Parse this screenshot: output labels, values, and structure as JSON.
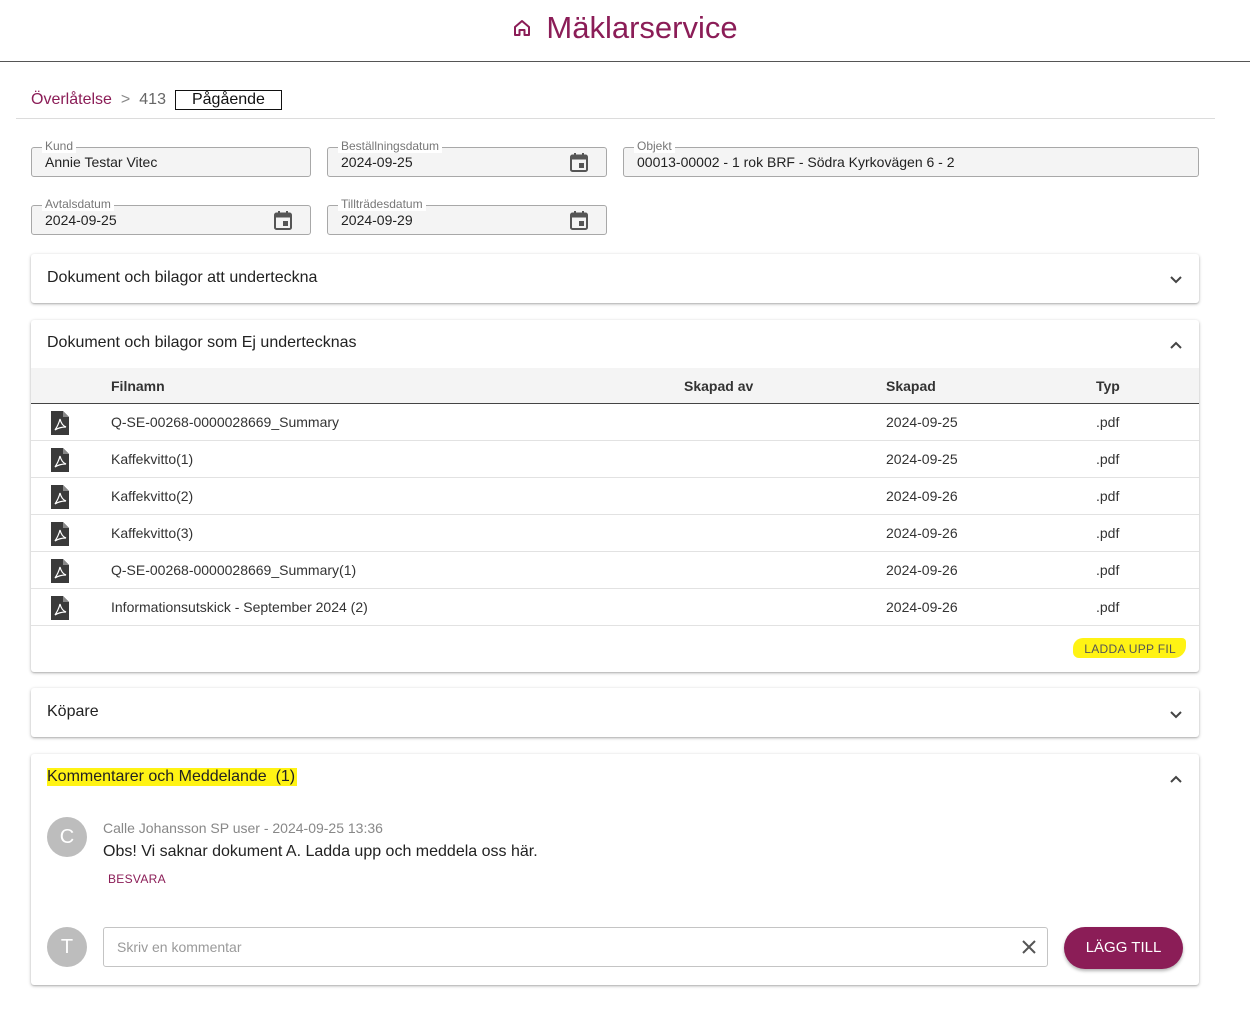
{
  "app": {
    "title": "Mäklarservice",
    "accent": "#8b1d57"
  },
  "breadcrumb": {
    "section": "Överlåtelse",
    "separator": ">",
    "id": "413",
    "status": "Pågående"
  },
  "fields": {
    "kund": {
      "label": "Kund",
      "value": "Annie Testar Vitec"
    },
    "bestallningsdatum": {
      "label": "Beställningsdatum",
      "value": "2024-09-25"
    },
    "objekt": {
      "label": "Objekt",
      "value": "00013-00002 - 1 rok BRF - Södra Kyrkovägen 6 - 2"
    },
    "avtalsdatum": {
      "label": "Avtalsdatum",
      "value": "2024-09-25"
    },
    "tilltradesdatum": {
      "label": "Tillträdesdatum",
      "value": "2024-09-29"
    }
  },
  "sections": {
    "sign": {
      "title": "Dokument och bilagor att underteckna",
      "expanded": false
    },
    "nosign": {
      "title": "Dokument och bilagor som Ej undertecknas",
      "expanded": true,
      "columns": {
        "name": "Filnamn",
        "created_by": "Skapad av",
        "created": "Skapad",
        "type": "Typ"
      },
      "rows": [
        {
          "name": "Q-SE-00268-0000028669_Summary",
          "created_by": "",
          "created": "2024-09-25",
          "type": ".pdf"
        },
        {
          "name": "Kaffekvitto(1)",
          "created_by": "",
          "created": "2024-09-25",
          "type": ".pdf"
        },
        {
          "name": "Kaffekvitto(2)",
          "created_by": "",
          "created": "2024-09-26",
          "type": ".pdf"
        },
        {
          "name": "Kaffekvitto(3)",
          "created_by": "",
          "created": "2024-09-26",
          "type": ".pdf"
        },
        {
          "name": "Q-SE-00268-0000028669_Summary(1)",
          "created_by": "",
          "created": "2024-09-26",
          "type": ".pdf"
        },
        {
          "name": "Informationsutskick - September 2024 (2)",
          "created_by": "",
          "created": "2024-09-26",
          "type": ".pdf"
        }
      ],
      "upload_label": "LADDA UPP FIL"
    },
    "buyers": {
      "title": "Köpare",
      "expanded": false
    },
    "comments": {
      "title": "Kommentarer och Meddelande",
      "count": "(1)",
      "expanded": true,
      "items": [
        {
          "initial": "C",
          "meta": "Calle Johansson SP user - 2024-09-25 13:36",
          "text": "Obs! Vi saknar dokument A. Ladda upp och meddela oss här.",
          "reply_label": "BESVARA"
        }
      ],
      "current_user_initial": "T",
      "input_placeholder": "Skriv en kommentar",
      "input_value": "",
      "add_label": "LÄGG TILL"
    }
  },
  "icons": [
    "home-icon",
    "calendar-icon",
    "chevron-down-icon",
    "chevron-up-icon",
    "pdf-file-icon",
    "clear-icon"
  ],
  "highlight_color": "#fff314"
}
